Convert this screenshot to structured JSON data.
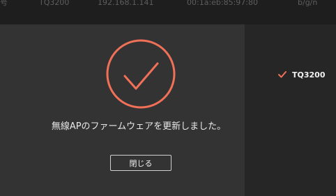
{
  "table": {
    "row": {
      "col0": "号",
      "model": "TQ3200",
      "ip": "192.168.1.141",
      "mac": "00:1a:eb:85:97:80",
      "standard": "b/g/n"
    }
  },
  "modal": {
    "message": "無線APのファームウェアを更新しました。",
    "close_label": "閉じる"
  },
  "side_panel": {
    "device_label": "TQ3200"
  },
  "colors": {
    "accent": "#f07058",
    "modal_background": "#333333",
    "panel_background": "#262626"
  }
}
